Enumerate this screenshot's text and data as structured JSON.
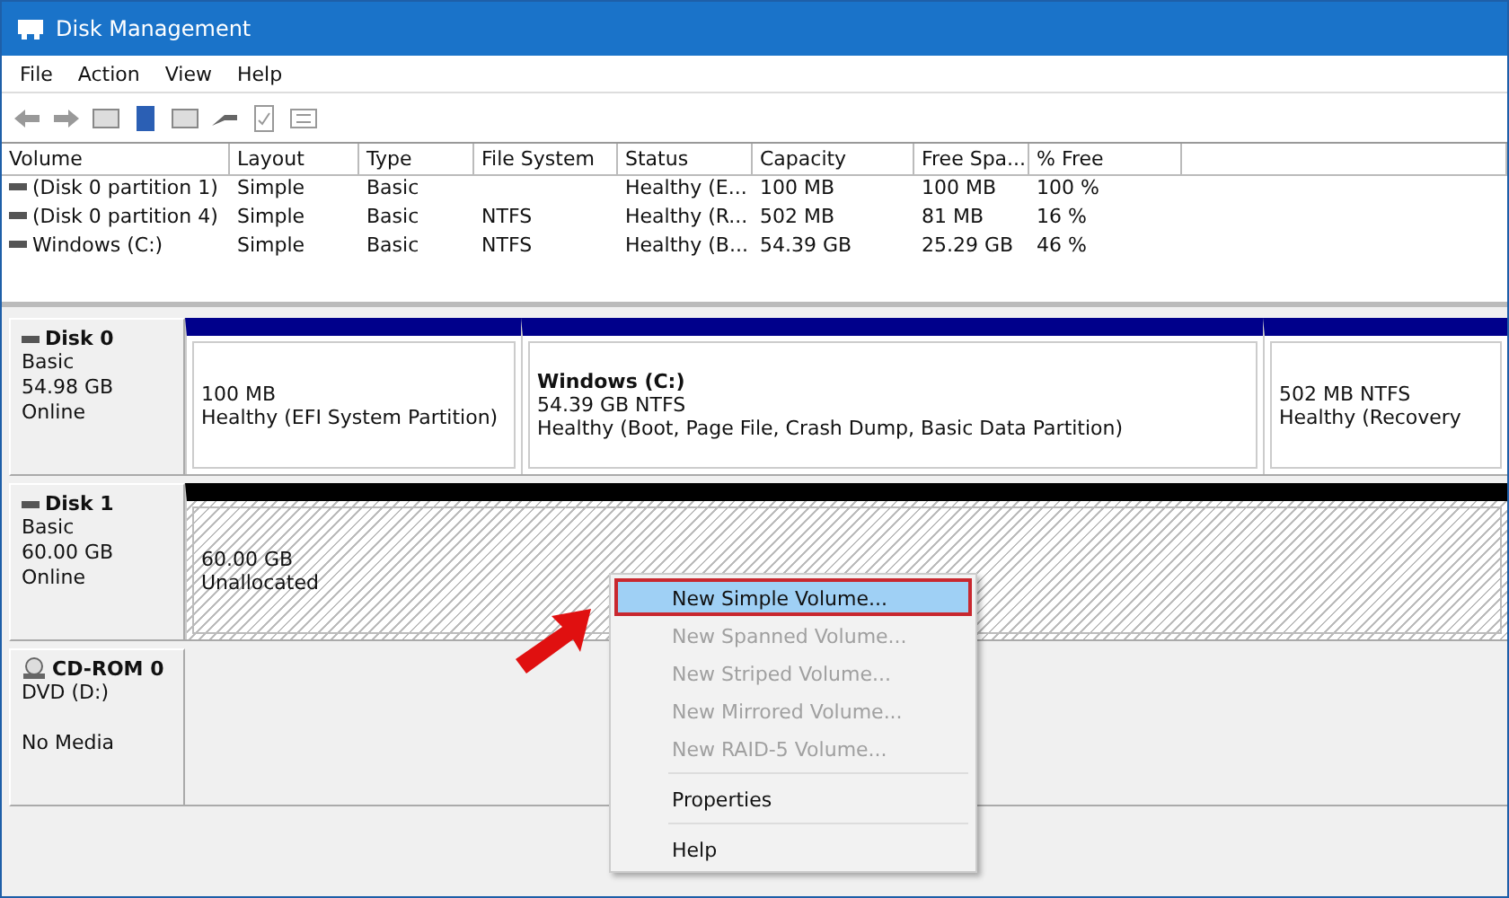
{
  "window": {
    "title": "Disk Management"
  },
  "menu": [
    "File",
    "Action",
    "View",
    "Help"
  ],
  "table": {
    "columns": [
      "Volume",
      "Layout",
      "Type",
      "File System",
      "Status",
      "Capacity",
      "Free Spa...",
      "% Free"
    ],
    "rows": [
      [
        "(Disk 0 partition 1)",
        "Simple",
        "Basic",
        "",
        "Healthy (E...",
        "100 MB",
        "100 MB",
        "100 %"
      ],
      [
        "(Disk 0 partition 4)",
        "Simple",
        "Basic",
        "NTFS",
        "Healthy (R...",
        "502 MB",
        "81 MB",
        "16 %"
      ],
      [
        "Windows (C:)",
        "Simple",
        "Basic",
        "NTFS",
        "Healthy (B...",
        "54.39 GB",
        "25.29 GB",
        "46 %"
      ]
    ]
  },
  "disks": [
    {
      "kind": "disk",
      "name": "Disk 0",
      "lines": [
        "Basic",
        "54.98 GB",
        "Online"
      ],
      "partitions": [
        {
          "lines": [
            "100 MB",
            "Healthy (EFI System Partition)"
          ],
          "hatched": false
        },
        {
          "title": "Windows  (C:)",
          "lines": [
            "54.39 GB NTFS",
            "Healthy (Boot, Page File, Crash Dump, Basic Data Partition)"
          ],
          "hatched": false
        },
        {
          "lines": [
            "502 MB NTFS",
            "Healthy (Recovery"
          ],
          "hatched": false
        }
      ]
    },
    {
      "kind": "disk",
      "name": "Disk 1",
      "lines": [
        "Basic",
        "60.00 GB",
        "Online"
      ],
      "partitions": [
        {
          "lines": [
            "60.00 GB",
            "Unallocated"
          ],
          "hatched": true
        }
      ]
    },
    {
      "kind": "cdrom",
      "name": "CD-ROM 0",
      "lines": [
        "DVD (D:)",
        "No Media"
      ]
    }
  ],
  "context_menu": [
    {
      "kind": "item",
      "label": "New Simple Volume...",
      "disabled": false,
      "selected": true
    },
    {
      "kind": "item",
      "label": "New Spanned Volume...",
      "disabled": true,
      "selected": false
    },
    {
      "kind": "item",
      "label": "New Striped Volume...",
      "disabled": true,
      "selected": false
    },
    {
      "kind": "item",
      "label": "New Mirrored Volume...",
      "disabled": true,
      "selected": false
    },
    {
      "kind": "item",
      "label": "New RAID-5 Volume...",
      "disabled": true,
      "selected": false
    },
    {
      "kind": "separator"
    },
    {
      "kind": "item",
      "label": "Properties",
      "disabled": false,
      "selected": false
    },
    {
      "kind": "separator"
    },
    {
      "kind": "item",
      "label": "Help",
      "disabled": false,
      "selected": false
    }
  ]
}
